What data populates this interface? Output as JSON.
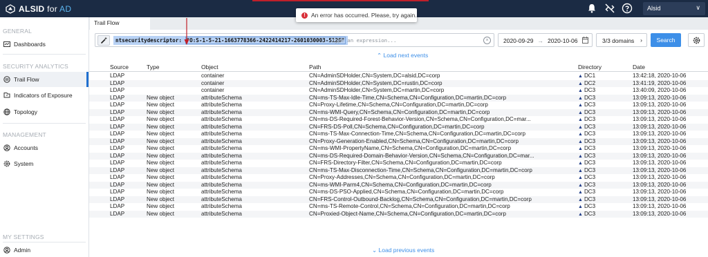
{
  "app": {
    "brand_main": "ALSID",
    "brand_for": " for ",
    "brand_ad": "AD",
    "user": "Alsid"
  },
  "toast": {
    "message": "An error has occurred. Please, try again."
  },
  "tab": {
    "label": "Trail Flow"
  },
  "sidebar": {
    "sections": {
      "general": "GENERAL",
      "security": "SECURITY ANALYTICS",
      "management": "MANAGEMENT",
      "settings": "MY SETTINGS"
    },
    "items": {
      "dashboards": "Dashboards",
      "trail_flow": "Trail Flow",
      "ioe": "Indicators of Exposure",
      "topology": "Topology",
      "accounts": "Accounts",
      "system": "System",
      "admin": "Admin"
    }
  },
  "filter": {
    "attribute": "ntsecuritydescriptor:",
    "value": "\"O:S-1-5-21-1663778366-2422414217-2601030003-512G\"",
    "placeholder": "Type an expression..."
  },
  "dates": {
    "from": "2020-09-29",
    "arrow": "→",
    "to": "2020-10-06"
  },
  "domains_label": "3/3 domains",
  "search_label": "Search",
  "load_next": "Load next events",
  "load_previous": "Load previous events",
  "columns": {
    "source": "Source",
    "type": "Type",
    "object": "Object",
    "path": "Path",
    "directory": "Directory",
    "date": "Date"
  },
  "rows": [
    {
      "source": "LDAP",
      "type": "",
      "object": "container",
      "path": "CN=AdminSDHolder,CN=System,DC=alsid,DC=corp",
      "directory": "DC1",
      "date": "13:42:18, 2020-10-06"
    },
    {
      "source": "LDAP",
      "type": "",
      "object": "container",
      "path": "CN=AdminSDHolder,CN=System,DC=rustin,DC=corp",
      "directory": "DC2",
      "date": "13:41:19, 2020-10-06"
    },
    {
      "source": "LDAP",
      "type": "",
      "object": "container",
      "path": "CN=AdminSDHolder,CN=System,DC=martin,DC=corp",
      "directory": "DC3",
      "date": "13:40:09, 2020-10-06"
    },
    {
      "source": "LDAP",
      "type": "New object",
      "object": "attributeSchema",
      "path": "CN=ms-TS-Max-Idle-Time,CN=Schema,CN=Configuration,DC=martin,DC=corp",
      "directory": "DC3",
      "date": "13:09:13, 2020-10-06"
    },
    {
      "source": "LDAP",
      "type": "New object",
      "object": "attributeSchema",
      "path": "CN=Proxy-Lifetime,CN=Schema,CN=Configuration,DC=martin,DC=corp",
      "directory": "DC3",
      "date": "13:09:13, 2020-10-06"
    },
    {
      "source": "LDAP",
      "type": "New object",
      "object": "attributeSchema",
      "path": "CN=ms-WMI-Query,CN=Schema,CN=Configuration,DC=martin,DC=corp",
      "directory": "DC3",
      "date": "13:09:13, 2020-10-06"
    },
    {
      "source": "LDAP",
      "type": "New object",
      "object": "attributeSchema",
      "path": "CN=ms-DS-Required-Forest-Behavior-Version,CN=Schema,CN=Configuration,DC=mar...",
      "directory": "DC3",
      "date": "13:09:13, 2020-10-06"
    },
    {
      "source": "LDAP",
      "type": "New object",
      "object": "attributeSchema",
      "path": "CN=FRS-DS-Poll,CN=Schema,CN=Configuration,DC=martin,DC=corp",
      "directory": "DC3",
      "date": "13:09:13, 2020-10-06"
    },
    {
      "source": "LDAP",
      "type": "New object",
      "object": "attributeSchema",
      "path": "CN=ms-TS-Max-Connection-Time,CN=Schema,CN=Configuration,DC=martin,DC=corp",
      "directory": "DC3",
      "date": "13:09:13, 2020-10-06"
    },
    {
      "source": "LDAP",
      "type": "New object",
      "object": "attributeSchema",
      "path": "CN=Proxy-Generation-Enabled,CN=Schema,CN=Configuration,DC=martin,DC=corp",
      "directory": "DC3",
      "date": "13:09:13, 2020-10-06"
    },
    {
      "source": "LDAP",
      "type": "New object",
      "object": "attributeSchema",
      "path": "CN=ms-WMI-PropertyName,CN=Schema,CN=Configuration,DC=martin,DC=corp",
      "directory": "DC3",
      "date": "13:09:13, 2020-10-06"
    },
    {
      "source": "LDAP",
      "type": "New object",
      "object": "attributeSchema",
      "path": "CN=ms-DS-Required-Domain-Behavior-Version,CN=Schema,CN=Configuration,DC=mar...",
      "directory": "DC3",
      "date": "13:09:13, 2020-10-06"
    },
    {
      "source": "LDAP",
      "type": "New object",
      "object": "attributeSchema",
      "path": "CN=FRS-Directory-Filter,CN=Schema,CN=Configuration,DC=martin,DC=corp",
      "directory": "DC3",
      "date": "13:09:13, 2020-10-06"
    },
    {
      "source": "LDAP",
      "type": "New object",
      "object": "attributeSchema",
      "path": "CN=ms-TS-Max-Disconnection-Time,CN=Schema,CN=Configuration,DC=martin,DC=corp",
      "directory": "DC3",
      "date": "13:09:13, 2020-10-06"
    },
    {
      "source": "LDAP",
      "type": "New object",
      "object": "attributeSchema",
      "path": "CN=Proxy-Addresses,CN=Schema,CN=Configuration,DC=martin,DC=corp",
      "directory": "DC3",
      "date": "13:09:13, 2020-10-06"
    },
    {
      "source": "LDAP",
      "type": "New object",
      "object": "attributeSchema",
      "path": "CN=ms-WMI-Parm4,CN=Schema,CN=Configuration,DC=martin,DC=corp",
      "directory": "DC3",
      "date": "13:09:13, 2020-10-06"
    },
    {
      "source": "LDAP",
      "type": "New object",
      "object": "attributeSchema",
      "path": "CN=ms-DS-PSO-Applied,CN=Schema,CN=Configuration,DC=martin,DC=corp",
      "directory": "DC3",
      "date": "13:09:13, 2020-10-06"
    },
    {
      "source": "LDAP",
      "type": "New object",
      "object": "attributeSchema",
      "path": "CN=FRS-Control-Outbound-Backlog,CN=Schema,CN=Configuration,DC=martin,DC=corp",
      "directory": "DC3",
      "date": "13:09:13, 2020-10-06"
    },
    {
      "source": "LDAP",
      "type": "New object",
      "object": "attributeSchema",
      "path": "CN=ms-TS-Remote-Control,CN=Schema,CN=Configuration,DC=martin,DC=corp",
      "directory": "DC3",
      "date": "13:09:13, 2020-10-06"
    },
    {
      "source": "LDAP",
      "type": "New object",
      "object": "attributeSchema",
      "path": "CN=Proxied-Object-Name,CN=Schema,CN=Configuration,DC=martin,DC=corp",
      "directory": "DC3",
      "date": "13:09:13, 2020-10-06"
    }
  ],
  "colors": {
    "topbar": "#1b2b44",
    "accent": "#3d8fe8",
    "error": "#d9313b",
    "selection": "#b8d2f5"
  },
  "icons": [
    "alsid-logo-icon",
    "bell-icon",
    "link-off-icon",
    "help-icon",
    "chevron-down-icon",
    "dashboard-icon",
    "trail-flow-icon",
    "ioe-icon",
    "topology-icon",
    "accounts-icon",
    "gear-icon",
    "admin-icon",
    "magic-wand-icon",
    "error-icon",
    "clear-icon",
    "calendar-icon",
    "chevron-right-icon"
  ]
}
